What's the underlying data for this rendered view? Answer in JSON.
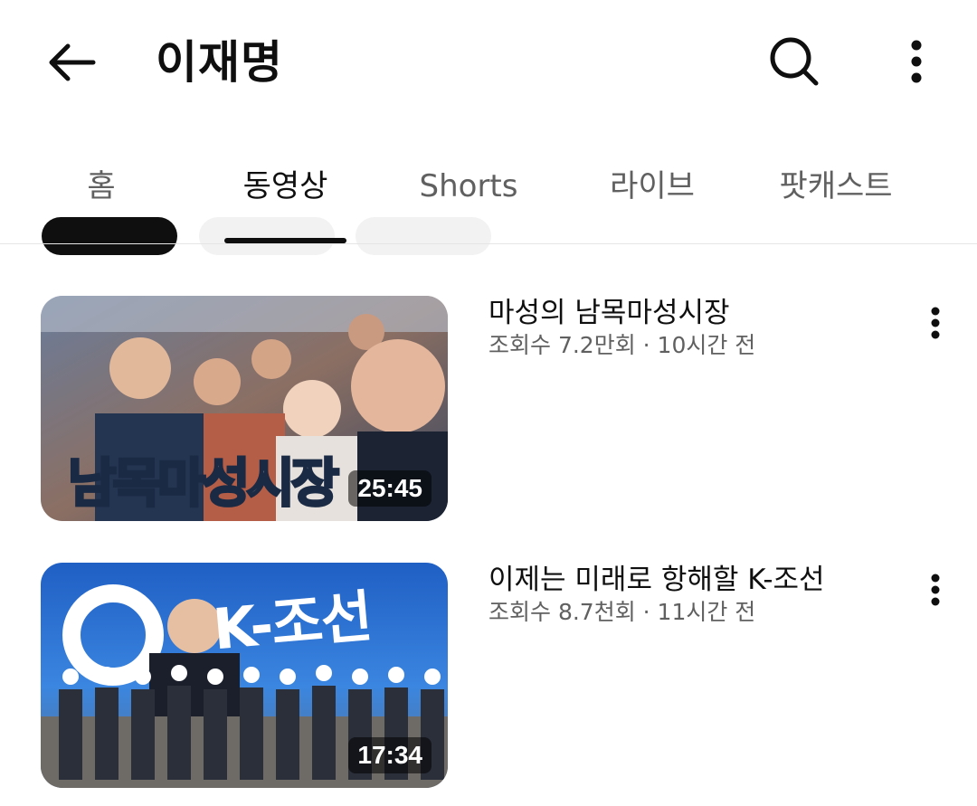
{
  "header": {
    "title": "이재명",
    "back_icon": "arrow-left-icon",
    "search_icon": "search-icon",
    "more_icon": "more-vert-icon"
  },
  "tabs": [
    {
      "label": "홈",
      "active": false
    },
    {
      "label": "동영상",
      "active": true
    },
    {
      "label": "Shorts",
      "active": false
    },
    {
      "label": "라이브",
      "active": false
    },
    {
      "label": "팟캐스트",
      "active": false
    }
  ],
  "videos": [
    {
      "title": "마성의 남목마성시장",
      "meta": "조회수 7.2만회 · 10시간 전",
      "duration": "25:45",
      "thumb_text": "남목마성시장"
    },
    {
      "title": "이제는 미래로 항해할 K-조선",
      "meta": "조회수 8.7천회 · 11시간 전",
      "duration": "17:34",
      "thumb_text": "K-조선"
    }
  ],
  "colors": {
    "text_primary": "#0f0f0f",
    "text_secondary": "#606060",
    "divider": "#e5e5e5"
  }
}
